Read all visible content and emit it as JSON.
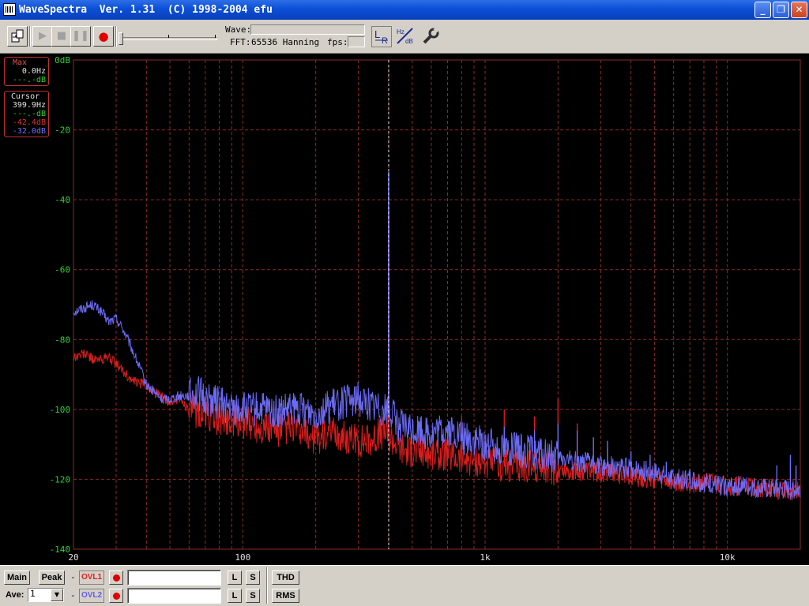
{
  "window": {
    "title": "WaveSpectra  Ver. 1.31  (C) 1998-2004 efu",
    "minimize_icon": "minimize-icon",
    "maximize_icon": "restore-icon",
    "close_icon": "close-icon"
  },
  "toolbar": {
    "wave_label": "Wave:",
    "fft_label": "FFT:",
    "fft_value": "65536 Hanning",
    "fps_label": "fps:",
    "lr_label": "L",
    "lr_sub": "R",
    "hz_label": "Hz",
    "db_label": "dB",
    "icons": [
      "open-file-icon",
      "play-icon",
      "stop-icon",
      "pause-icon",
      "record-icon",
      "lr-channel-icon",
      "hz-db-icon",
      "settings-wrench-icon"
    ]
  },
  "max_box": {
    "label": "Max",
    "freq": "0.0Hz",
    "level": "---.-dB"
  },
  "cursor_box": {
    "label": "Cursor",
    "freq": "399.9Hz",
    "level_green": "---.-dB",
    "level_red": "-42.4dB",
    "level_blue": "-32.0dB"
  },
  "colors": {
    "series_left": "#e02020",
    "series_right": "#7070ff",
    "grid": "#8a2a2a",
    "axis_text": "#30d030",
    "freq_text": "#e0e0e0",
    "cursor": "#e0e0e0"
  },
  "chart_data": {
    "type": "line",
    "x_scale": "log",
    "xlim": [
      20,
      20000
    ],
    "ylim": [
      -140,
      0
    ],
    "grid": true,
    "y_tick_labels": [
      "0dB",
      "-20",
      "-40",
      "-60",
      "-80",
      "-100",
      "-120",
      "-140"
    ],
    "y_tick_values": [
      0,
      -20,
      -40,
      -60,
      -80,
      -100,
      -120,
      -140
    ],
    "x_tick_labels": [
      "20",
      "100",
      "1k",
      "10k"
    ],
    "x_tick_values": [
      20,
      100,
      1000,
      10000
    ],
    "cursor_freq": 399.9,
    "series": [
      {
        "color": "#e02020",
        "points": [
          [
            20,
            -85
          ],
          [
            22,
            -84
          ],
          [
            25,
            -86
          ],
          [
            28,
            -85
          ],
          [
            31,
            -88
          ],
          [
            35,
            -92
          ],
          [
            40,
            -93
          ],
          [
            45,
            -96
          ],
          [
            50,
            -98
          ],
          [
            55,
            -97
          ],
          [
            60,
            -100
          ],
          [
            70,
            -101
          ],
          [
            80,
            -103
          ],
          [
            90,
            -103
          ],
          [
            100,
            -104
          ],
          [
            120,
            -105
          ],
          [
            140,
            -106
          ],
          [
            160,
            -105
          ],
          [
            180,
            -107
          ],
          [
            200,
            -108
          ],
          [
            230,
            -107
          ],
          [
            260,
            -108
          ],
          [
            300,
            -109
          ],
          [
            350,
            -108
          ],
          [
            390,
            -106
          ],
          [
            399.9,
            -42.4
          ],
          [
            410,
            -108
          ],
          [
            450,
            -111
          ],
          [
            500,
            -112
          ],
          [
            550,
            -112
          ],
          [
            600,
            -113
          ],
          [
            700,
            -113
          ],
          [
            800,
            -114
          ],
          [
            900,
            -114
          ],
          [
            1000,
            -115
          ],
          [
            1200,
            -116
          ],
          [
            1500,
            -116
          ],
          [
            2000,
            -117
          ],
          [
            2500,
            -118
          ],
          [
            3000,
            -118
          ],
          [
            4000,
            -119
          ],
          [
            5000,
            -120
          ],
          [
            6000,
            -121
          ],
          [
            7000,
            -121
          ],
          [
            8000,
            -121
          ],
          [
            10000,
            -122
          ],
          [
            12000,
            -122
          ],
          [
            15000,
            -123
          ],
          [
            17000,
            -123
          ],
          [
            20000,
            -123
          ]
        ],
        "spikes": [
          [
            799.8,
            -102
          ],
          [
            1199.7,
            -100
          ],
          [
            1599.6,
            -102
          ],
          [
            1999.5,
            -97
          ],
          [
            2399.4,
            -104
          ],
          [
            2799.3,
            -108
          ],
          [
            3199.2,
            -111
          ],
          [
            3999,
            -112
          ],
          [
            4798.8,
            -114
          ],
          [
            5598.6,
            -115
          ],
          [
            16000,
            -125
          ],
          [
            18200,
            -115
          ],
          [
            19200,
            -117
          ]
        ]
      },
      {
        "color": "#7070ff",
        "points": [
          [
            20,
            -72
          ],
          [
            22,
            -71
          ],
          [
            24,
            -70
          ],
          [
            26,
            -72
          ],
          [
            28,
            -75
          ],
          [
            30,
            -74
          ],
          [
            32,
            -77
          ],
          [
            35,
            -83
          ],
          [
            38,
            -89
          ],
          [
            40,
            -93
          ],
          [
            43,
            -95
          ],
          [
            46,
            -97
          ],
          [
            50,
            -97
          ],
          [
            55,
            -96
          ],
          [
            60,
            -96
          ],
          [
            65,
            -95
          ],
          [
            70,
            -97
          ],
          [
            80,
            -98
          ],
          [
            90,
            -100
          ],
          [
            100,
            -100
          ],
          [
            120,
            -100
          ],
          [
            140,
            -101
          ],
          [
            160,
            -100
          ],
          [
            180,
            -100
          ],
          [
            200,
            -101
          ],
          [
            230,
            -99
          ],
          [
            260,
            -98
          ],
          [
            300,
            -97
          ],
          [
            350,
            -99
          ],
          [
            390,
            -100
          ],
          [
            399.9,
            -32.0
          ],
          [
            410,
            -101
          ],
          [
            450,
            -105
          ],
          [
            500,
            -106
          ],
          [
            550,
            -106
          ],
          [
            600,
            -107
          ],
          [
            700,
            -106
          ],
          [
            800,
            -108
          ],
          [
            900,
            -109
          ],
          [
            1000,
            -110
          ],
          [
            1200,
            -111
          ],
          [
            1500,
            -112
          ],
          [
            2000,
            -114
          ],
          [
            2500,
            -115
          ],
          [
            3000,
            -116
          ],
          [
            4000,
            -117
          ],
          [
            5000,
            -118
          ],
          [
            6000,
            -120
          ],
          [
            7000,
            -120
          ],
          [
            8000,
            -121
          ],
          [
            10000,
            -122
          ],
          [
            12000,
            -122
          ],
          [
            15000,
            -123
          ],
          [
            17000,
            -123
          ],
          [
            20000,
            -123
          ]
        ],
        "spikes": [
          [
            799.8,
            -108
          ],
          [
            1199.7,
            -105
          ],
          [
            1599.6,
            -106
          ],
          [
            1999.5,
            -104
          ],
          [
            2399.4,
            -106
          ],
          [
            2799.3,
            -108
          ],
          [
            3199.2,
            -109
          ],
          [
            3999,
            -112
          ],
          [
            4798.8,
            -113
          ],
          [
            5598.6,
            -115
          ],
          [
            7000,
            -117
          ],
          [
            8500,
            -119
          ],
          [
            16000,
            -116
          ],
          [
            18200,
            -113
          ],
          [
            19200,
            -116
          ]
        ]
      }
    ]
  },
  "bottom": {
    "main_label": "Main",
    "peak_label": "Peak",
    "dash1": "-",
    "dash2": "-",
    "ovl1_label": "OVL1",
    "ovl2_label": "OVL2",
    "ave_label": "Ave:",
    "ave_value": "1",
    "l_label": "L",
    "s_label": "S",
    "thd_label": "THD",
    "rms_label": "RMS"
  }
}
